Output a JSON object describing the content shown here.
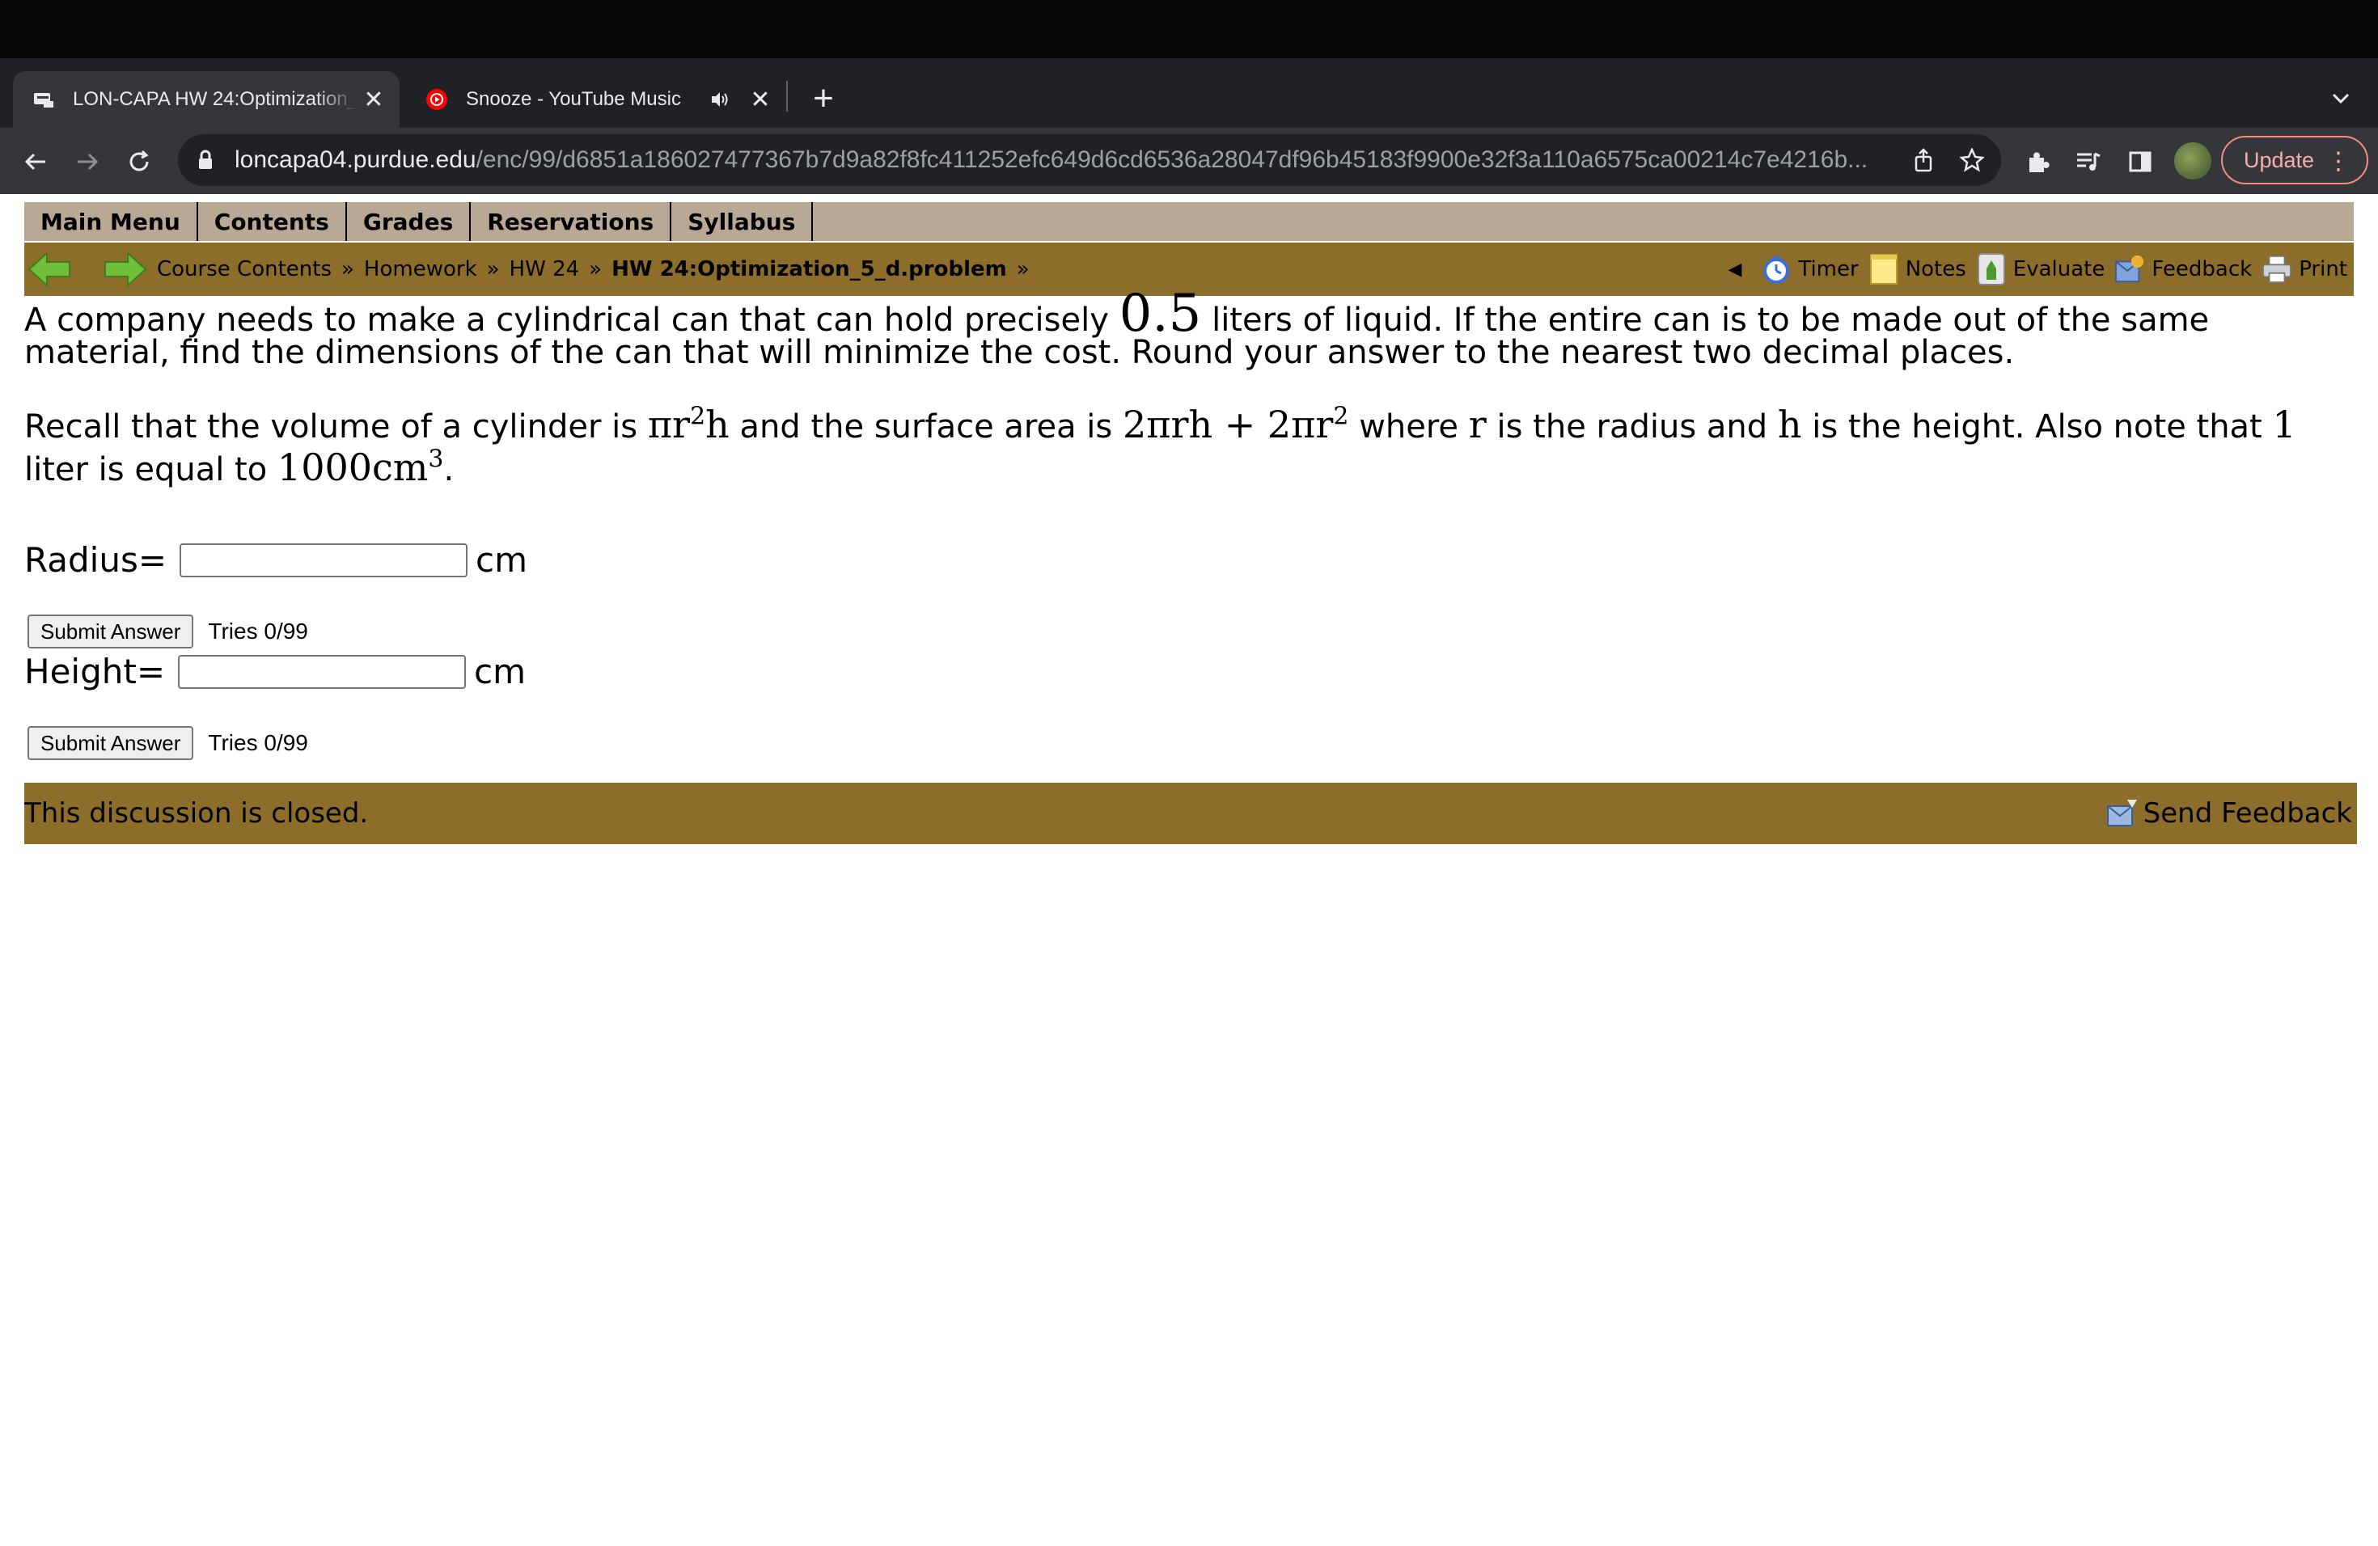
{
  "browser": {
    "tabs": [
      {
        "title": "LON-CAPA HW 24:Optimization_5_d.problem",
        "close": "✕",
        "active": true
      },
      {
        "title": "Snooze - YouTube Music",
        "close": "✕",
        "active": false
      }
    ],
    "new_tab": "+",
    "url_host": "loncapa04.purdue.edu",
    "url_path": "/enc/99/d6851a186027477367b7d9a82f8fc411252efc649d6cd6536a28047df96b45183f9900e32f3a110a6575ca00214c7e4216b...",
    "update_label": "Update",
    "update_menu": "⋮",
    "accent_update": "#f28b82"
  },
  "menu": {
    "items": [
      "Main Menu",
      "Contents",
      "Grades",
      "Reservations",
      "Syllabus"
    ]
  },
  "nav": {
    "breadcrumb": [
      "Course Contents",
      "Homework",
      "HW 24",
      "HW 24:Optimization_5_d.problem"
    ],
    "separator": "»",
    "collapse": "◀",
    "tools": [
      "Timer",
      "Notes",
      "Evaluate",
      "Feedback",
      "Print"
    ]
  },
  "problem": {
    "p1_a": "A company needs to make a cylindrical can that can hold precisely",
    "volume_value": "0.5",
    "p1_b": "liters of liquid. If the entire can is to be made out of the same material, find the dimensions of the can that will minimize the cost. Round your answer to the nearest two decimal places.",
    "p2_a": "Recall that the volume of a cylinder is",
    "vol_formula": "πr",
    "vol_exp": "2",
    "vol_tail": "h",
    "p2_b": "and the surface area is",
    "sa_formula": "2πrh + 2πr",
    "sa_exp": "2",
    "p2_c": "where",
    "var_r": "r",
    "p2_d": "is the radius and",
    "var_h": "h",
    "p2_e": "is the height. Also note that",
    "one": "1",
    "p2_f": "liter is equal to",
    "cm_value": "1000cm",
    "cm_exp": "3",
    "p2_end": "."
  },
  "answers": [
    {
      "label": "Radius=",
      "unit": "cm",
      "value": "",
      "submit": "Submit Answer",
      "tries": "Tries 0/99"
    },
    {
      "label": "Height=",
      "unit": "cm",
      "value": "",
      "submit": "Submit Answer",
      "tries": "Tries 0/99"
    }
  ],
  "footer": {
    "status": "This discussion is closed.",
    "send_feedback": "Send Feedback"
  },
  "colors": {
    "menubar": "#b8a894",
    "navbar": "#8c6e2a",
    "arrow_green": "#6fbf3a"
  }
}
